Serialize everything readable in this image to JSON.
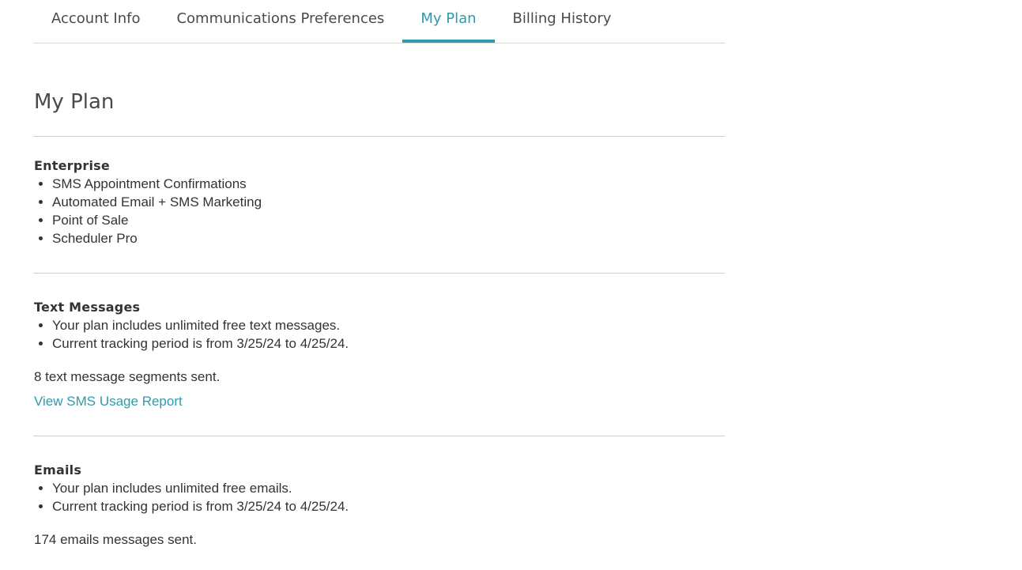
{
  "tabs": [
    {
      "label": "Account Info",
      "active": false
    },
    {
      "label": "Communications Preferences",
      "active": false
    },
    {
      "label": "My Plan",
      "active": true
    },
    {
      "label": "Billing History",
      "active": false
    }
  ],
  "page": {
    "title": "My Plan"
  },
  "plan": {
    "name": "Enterprise",
    "features": [
      "SMS Appointment Confirmations",
      "Automated Email + SMS Marketing",
      "Point of Sale",
      "Scheduler Pro"
    ]
  },
  "text_messages": {
    "title": "Text Messages",
    "items": [
      "Your plan includes unlimited free text messages.",
      "Current tracking period is from 3/25/24 to 4/25/24."
    ],
    "sent": "8 text message segments sent.",
    "report_link": "View SMS Usage Report"
  },
  "emails": {
    "title": "Emails",
    "items": [
      "Your plan includes unlimited free emails.",
      "Current tracking period is from 3/25/24 to 4/25/24."
    ],
    "sent": "174 emails messages sent."
  },
  "colors": {
    "accent": "#2f9bab",
    "text": "#333333",
    "divider": "#cfcfcf"
  }
}
